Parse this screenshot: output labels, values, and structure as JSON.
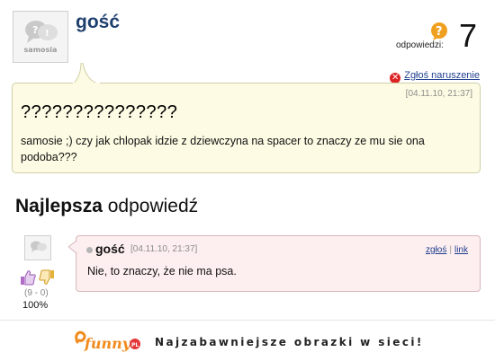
{
  "question": {
    "author": "gość",
    "avatar_brand": "samosia",
    "answers_label": "odpowiedzi:",
    "answers_count": "7",
    "report_label": "Zgłoś naruszenie",
    "date": "[04.11.10, 21:37]",
    "title": "???????????????",
    "body": "samosie ;) czy jak chlopak idzie z dziewczyna na spacer to znaczy ze mu sie ona podoba???"
  },
  "best_answer": {
    "heading_bold": "Najlepsza",
    "heading_rest": " odpowiedź",
    "author": "gość",
    "date": "[04.11.10, 21:37]",
    "report_link": "zgłoś",
    "link_label": "link",
    "separator": "|",
    "text": "Nie, to znaczy, że nie ma psa.",
    "score": "(9 - 0)",
    "percent": "100%"
  },
  "footer": {
    "logo_text": "funny",
    "logo_badge": "PL",
    "tagline": "Najzabawniejsze obrazki w sieci!"
  },
  "colors": {
    "author_blue": "#1f3f6e",
    "question_bg": "#fdfbe3",
    "answer_bg": "#fdeef0",
    "report_red": "#dd2222",
    "answers_icon_orange": "#f0a020",
    "logo_orange": "#f08a1c"
  },
  "icons": [
    "chat-bubbles-icon",
    "question-mark-icon",
    "report-x-icon",
    "thumb-up-icon",
    "thumb-down-icon",
    "funny-logo-icon"
  ]
}
